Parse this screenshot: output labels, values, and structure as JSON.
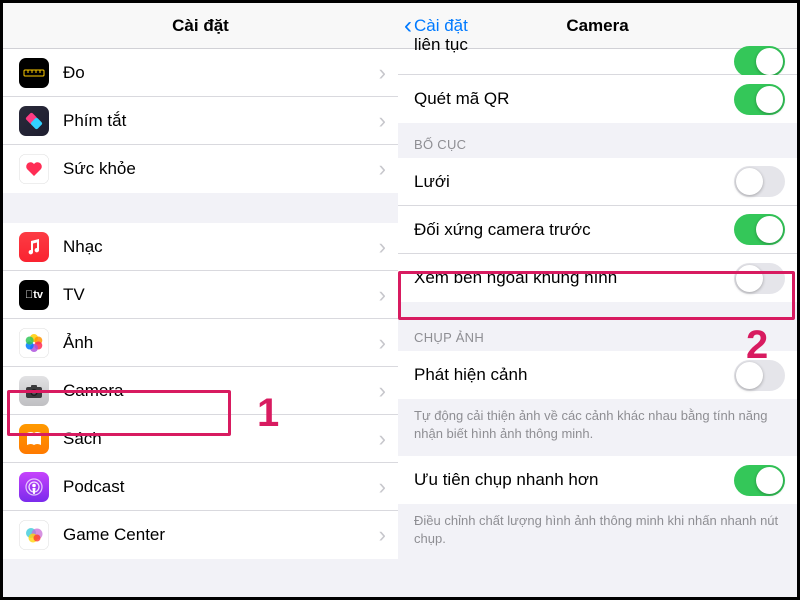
{
  "annotations": {
    "num1": "1",
    "num2": "2"
  },
  "left": {
    "header_title": "Cài đặt",
    "section1": [
      {
        "key": "measure",
        "label": "Đo",
        "icon": "measure-icon"
      },
      {
        "key": "shortcuts",
        "label": "Phím tắt",
        "icon": "shortcuts-icon"
      },
      {
        "key": "health",
        "label": "Sức khỏe",
        "icon": "health-icon"
      }
    ],
    "section2": [
      {
        "key": "music",
        "label": "Nhạc",
        "icon": "music-icon"
      },
      {
        "key": "tv",
        "label": "TV",
        "icon": "tv-icon"
      },
      {
        "key": "photos",
        "label": "Ảnh",
        "icon": "photos-icon"
      },
      {
        "key": "camera",
        "label": "Camera",
        "icon": "camera-icon"
      },
      {
        "key": "books",
        "label": "Sách",
        "icon": "books-icon"
      },
      {
        "key": "podcast",
        "label": "Podcast",
        "icon": "podcast-icon"
      },
      {
        "key": "gamectr",
        "label": "Game Center",
        "icon": "gamecenter-icon"
      }
    ]
  },
  "right": {
    "back_label": "Cài đặt",
    "header_title": "Camera",
    "partial_label": "liên tục",
    "qr_label": "Quét mã QR",
    "qr_on": true,
    "section_layout_title": "BỐ CỤC",
    "layout_rows": [
      {
        "key": "grid",
        "label": "Lưới",
        "on": false
      },
      {
        "key": "mirror",
        "label": "Đối xứng camera trước",
        "on": true
      },
      {
        "key": "view",
        "label": "Xem bên ngoài khung hình",
        "on": false
      }
    ],
    "section_capture_title": "CHỤP ẢNH",
    "scene_label": "Phát hiện cảnh",
    "scene_on": false,
    "scene_footer": "Tự động cải thiện ảnh về các cảnh khác nhau bằng tính năng nhận biết hình ảnh thông minh.",
    "faster_label": "Ưu tiên chụp nhanh hơn",
    "faster_on": true,
    "faster_footer": "Điều chỉnh chất lượng hình ảnh thông minh khi nhấn nhanh nút chụp."
  }
}
